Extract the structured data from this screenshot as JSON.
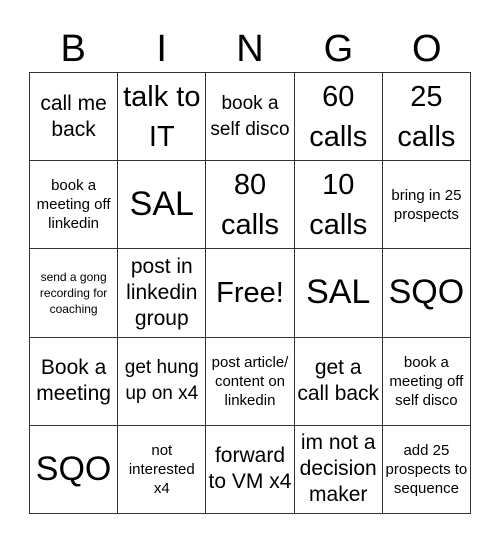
{
  "header": {
    "letters": [
      "B",
      "I",
      "N",
      "G",
      "O"
    ]
  },
  "cells": [
    "call me back",
    "talk to IT",
    "book a self disco",
    "60 calls",
    "25 calls",
    "book a meeting off linkedin",
    "SAL",
    "80 calls",
    "10 calls",
    "bring in 25 prospects",
    "send a gong recording for coaching",
    "post in linkedin group",
    "Free!",
    "SAL",
    "SQO",
    "Book a meeting",
    "get hung up on x4",
    "post article/ content on linkedin",
    "get a call back",
    "book a meeting off self disco",
    "SQO",
    "not interested x4",
    "forward to VM x4",
    "im not a decision maker",
    "add 25 prospects to sequence"
  ]
}
